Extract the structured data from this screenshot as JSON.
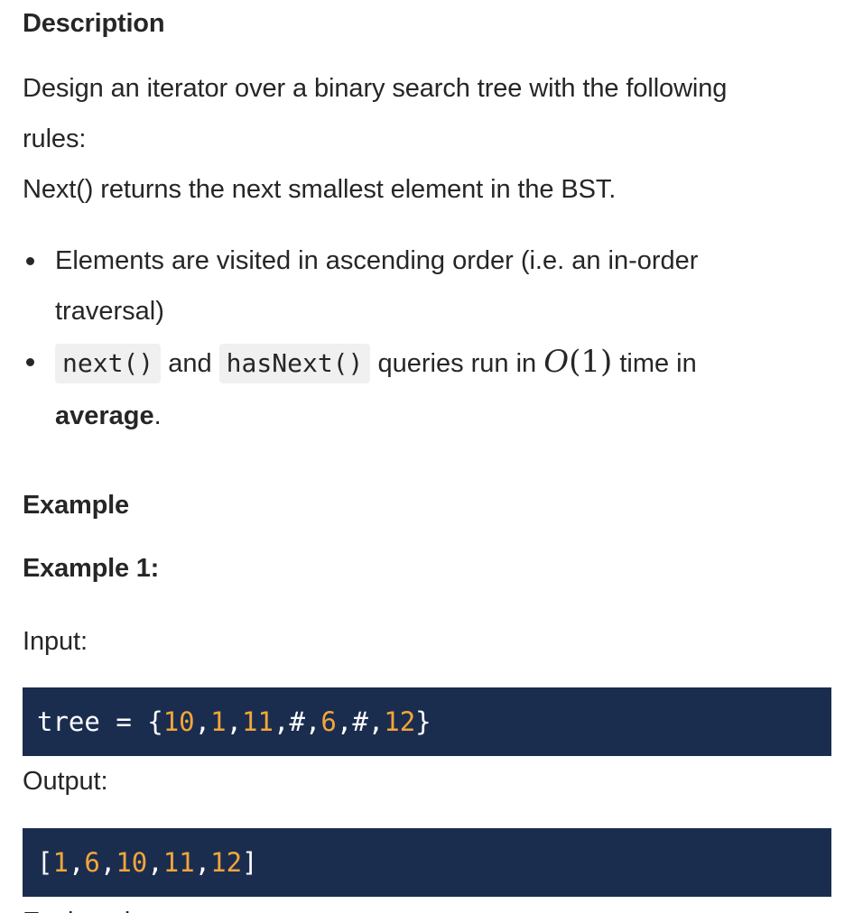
{
  "description": {
    "heading": "Description",
    "intro_line1": "Design an iterator over a binary search tree with the following",
    "intro_line2": "rules:",
    "next_line": "Next() returns the next smallest element in the BST.",
    "bullet1_line1": "Elements are visited in ascending order (i.e. an in-order",
    "bullet1_line2": "traversal)",
    "bullet2_code1": "next()",
    "bullet2_and": "and",
    "bullet2_code2": "hasNext()",
    "bullet2_text": "queries run in",
    "bullet2_math_o": "O",
    "bullet2_math_arg": "(1)",
    "bullet2_tail": "time in",
    "bullet2_bold": "average",
    "bullet2_end": "."
  },
  "example": {
    "heading": "Example",
    "subheading": "Example 1:",
    "input_label": "Input:",
    "input_code": {
      "lhs": "tree",
      "eq": "=",
      "open": "{",
      "tokens": [
        "10",
        ",",
        "1",
        ",",
        "11",
        ",",
        "#",
        ",",
        "6",
        ",",
        "#",
        ",",
        "12"
      ],
      "close": "}"
    },
    "output_label": "Output:",
    "output_code": {
      "open": "[",
      "tokens": [
        "1",
        ",",
        "6",
        ",",
        "10",
        ",",
        "11",
        ",",
        "12"
      ],
      "close": "]"
    },
    "next_label_cut": "Explanation:"
  },
  "colors": {
    "code_bg": "#1b2d4f",
    "code_number": "#f2a63a",
    "text": "#262626",
    "inline_code_bg": "#f0f0f0"
  }
}
